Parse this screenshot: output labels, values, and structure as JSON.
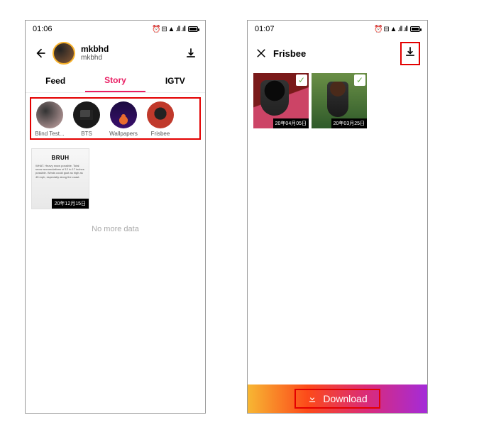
{
  "left": {
    "status": {
      "time": "01:06",
      "icons_text": "⏰ ⊟ ▲ .ıll .ıll",
      "battery_text": "87"
    },
    "profile": {
      "name": "mkbhd",
      "handle": "mkbhd"
    },
    "tabs": {
      "feed": "Feed",
      "story": "Story",
      "igtv": "IGTV"
    },
    "highlights": [
      {
        "label": "Blind Test..."
      },
      {
        "label": "BTS"
      },
      {
        "label": "Wallpapers"
      },
      {
        "label": "Frisbee"
      }
    ],
    "story_card": {
      "title": "BRUH",
      "body": "WHAT. Heavy snow possible. Total snow accumulations of 12 to 17 inches possible. Winds could gust as high as 45 mph, especially along the coast.",
      "date": "20年12月15日"
    },
    "no_more": "No more data"
  },
  "right": {
    "status": {
      "time": "01:07",
      "icons_text": "⏰ ⊟ ▲ .ıll .ıll",
      "battery_text": "87"
    },
    "title": "Frisbee",
    "tiles": [
      {
        "date": "20年04月05日"
      },
      {
        "date": "20年03月25日"
      }
    ],
    "download_label": "Download"
  }
}
